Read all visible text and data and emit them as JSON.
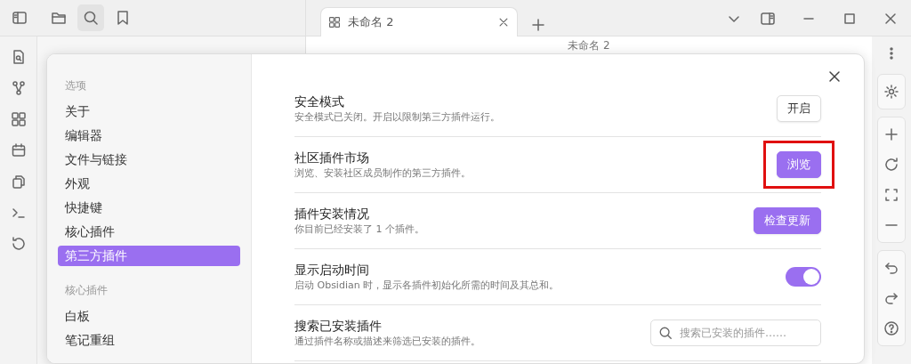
{
  "tabs": [
    {
      "label": "未命名 2",
      "selected": true
    }
  ],
  "view_title": "未命名 2",
  "settings": {
    "nav_sections": [
      {
        "heading": "选项",
        "items": [
          {
            "label": "关于",
            "selected": false
          },
          {
            "label": "编辑器",
            "selected": false
          },
          {
            "label": "文件与链接",
            "selected": false
          },
          {
            "label": "外观",
            "selected": false
          },
          {
            "label": "快捷键",
            "selected": false
          },
          {
            "label": "核心插件",
            "selected": false
          },
          {
            "label": "第三方插件",
            "selected": true
          }
        ]
      },
      {
        "heading": "核心插件",
        "items": [
          {
            "label": "白板",
            "selected": false
          },
          {
            "label": "笔记重组",
            "selected": false
          }
        ]
      }
    ],
    "rows": [
      {
        "title": "安全模式",
        "description": "安全模式已关闭。开启以限制第三方插件运行。",
        "kind": "button",
        "button": {
          "label": "开启",
          "primary": false,
          "highlighted": false
        }
      },
      {
        "title": "社区插件市场",
        "description": "浏览、安装社区成员制作的第三方插件。",
        "kind": "button",
        "button": {
          "label": "浏览",
          "primary": true,
          "highlighted": true
        }
      },
      {
        "title": "插件安装情况",
        "description": "你目前已经安装了 1 个插件。",
        "kind": "button",
        "button": {
          "label": "检查更新",
          "primary": true,
          "highlighted": false
        }
      },
      {
        "title": "显示启动时间",
        "description": "启动 Obsidian 时，显示各插件初始化所需的时间及其总和。",
        "kind": "toggle",
        "on": true
      },
      {
        "title": "搜索已安装插件",
        "description": "通过插件名称或描述来筛选已安装的插件。",
        "kind": "search",
        "placeholder": "搜索已安装的插件……"
      }
    ]
  }
}
